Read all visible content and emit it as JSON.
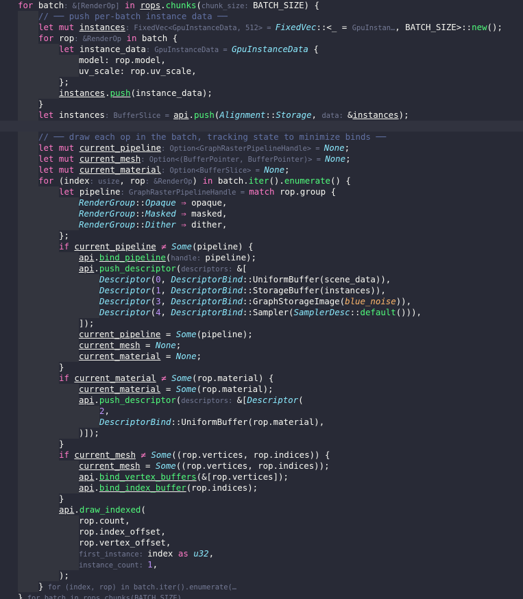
{
  "editor": {
    "theme": {
      "background": "#282a36",
      "keyword": "#ff79c6",
      "function": "#50fa7b",
      "type": "#8be9fd",
      "number": "#bd93f9",
      "comment": "#6272a4",
      "hint": "#747a95",
      "text": "#f8f8f2"
    },
    "lines": [
      {
        "indent": 0,
        "tokens": [
          [
            "kw",
            "for"
          ],
          [
            "pn",
            " batch"
          ],
          [
            "hint",
            ": &[RenderOp]"
          ],
          [
            "kw",
            " in "
          ],
          [
            "pn ul",
            "rops"
          ],
          [
            "pn",
            "."
          ],
          [
            "fn",
            "chunks"
          ],
          [
            "pn",
            "("
          ],
          [
            "hint",
            "chunk_size: "
          ],
          [
            "pn",
            "BATCH_SIZE) {"
          ]
        ]
      },
      {
        "indent": 1,
        "tokens": [
          [
            "cm",
            "// ── push per-batch instance data ──"
          ]
        ]
      },
      {
        "indent": 1,
        "tokens": [
          [
            "kw",
            "let mut "
          ],
          [
            "pn ul",
            "instances"
          ],
          [
            "hint",
            ": FixedVec<GpuInstanceData, 512> = "
          ],
          [
            "ty",
            "FixedVec"
          ],
          [
            "pn",
            "::<_ = "
          ],
          [
            "hint",
            "GpuInstan…"
          ],
          [
            "pn",
            ", BATCH_SIZE>::"
          ],
          [
            "fn",
            "new"
          ],
          [
            "pn",
            "();"
          ]
        ]
      },
      {
        "indent": 1,
        "tokens": [
          [
            "kw",
            "for "
          ],
          [
            "pn",
            "rop"
          ],
          [
            "hint",
            ": &RenderOp"
          ],
          [
            "kw",
            " in "
          ],
          [
            "pn",
            "batch {"
          ]
        ]
      },
      {
        "indent": 2,
        "tokens": [
          [
            "kw",
            "let "
          ],
          [
            "pn",
            "instance_data"
          ],
          [
            "hint",
            ": GpuInstanceData = "
          ],
          [
            "ty",
            "GpuInstanceData"
          ],
          [
            "pn",
            " {"
          ]
        ]
      },
      {
        "indent": 3,
        "tokens": [
          [
            "pn",
            "model: rop.model,"
          ]
        ]
      },
      {
        "indent": 3,
        "tokens": [
          [
            "pn",
            "uv_scale: rop.uv_scale,"
          ]
        ]
      },
      {
        "indent": 2,
        "tokens": [
          [
            "pn",
            "};"
          ]
        ]
      },
      {
        "indent": 2,
        "tokens": [
          [
            "pn ul",
            "instances"
          ],
          [
            "pn",
            "."
          ],
          [
            "fn ul",
            "push"
          ],
          [
            "pn",
            "(instance_data);"
          ]
        ]
      },
      {
        "indent": 1,
        "tokens": [
          [
            "pn",
            "}"
          ]
        ]
      },
      {
        "indent": 1,
        "tokens": [
          [
            "kw",
            "let "
          ],
          [
            "pn",
            "instances"
          ],
          [
            "hint",
            ": BufferSlice = "
          ],
          [
            "pn ul",
            "api"
          ],
          [
            "pn",
            "."
          ],
          [
            "fn",
            "push"
          ],
          [
            "pn",
            "("
          ],
          [
            "ty",
            "Alignment"
          ],
          [
            "pn",
            "::"
          ],
          [
            "ty",
            "Storage"
          ],
          [
            "pn",
            ", "
          ],
          [
            "hint",
            "data: "
          ],
          [
            "pn",
            "&"
          ],
          [
            "pn ul",
            "instances"
          ],
          [
            "pn",
            ");"
          ]
        ]
      },
      {
        "indent": 0,
        "tokens": [
          [
            "pn",
            ""
          ]
        ],
        "cursor": true
      },
      {
        "indent": 1,
        "tokens": [
          [
            "cm",
            "// ── draw each op in the batch, tracking state to minimize binds ──"
          ]
        ]
      },
      {
        "indent": 1,
        "tokens": [
          [
            "kw",
            "let mut "
          ],
          [
            "pn ul",
            "current_pipeline"
          ],
          [
            "hint",
            ": Option<GraphRasterPipelineHandle> = "
          ],
          [
            "ty",
            "None"
          ],
          [
            "pn",
            ";"
          ]
        ]
      },
      {
        "indent": 1,
        "tokens": [
          [
            "kw",
            "let mut "
          ],
          [
            "pn ul",
            "current_mesh"
          ],
          [
            "hint",
            ": Option<(BufferPointer, BufferPointer)> = "
          ],
          [
            "ty",
            "None"
          ],
          [
            "pn",
            ";"
          ]
        ]
      },
      {
        "indent": 1,
        "tokens": [
          [
            "kw",
            "let mut "
          ],
          [
            "pn ul",
            "current_material"
          ],
          [
            "hint",
            ": Option<BufferSlice> = "
          ],
          [
            "ty",
            "None"
          ],
          [
            "pn",
            ";"
          ]
        ]
      },
      {
        "indent": 1,
        "tokens": [
          [
            "kw",
            "for "
          ],
          [
            "pn",
            "(index"
          ],
          [
            "hint",
            ": usize"
          ],
          [
            "pn",
            ", rop"
          ],
          [
            "hint",
            ": &RenderOp"
          ],
          [
            "pn",
            ")"
          ],
          [
            "kw",
            " in "
          ],
          [
            "pn",
            "batch."
          ],
          [
            "fn",
            "iter"
          ],
          [
            "pn",
            "()."
          ],
          [
            "fn",
            "enumerate"
          ],
          [
            "pn",
            "() {"
          ]
        ]
      },
      {
        "indent": 2,
        "tokens": [
          [
            "kw",
            "let "
          ],
          [
            "pn",
            "pipeline"
          ],
          [
            "hint",
            ": GraphRasterPipelineHandle = "
          ],
          [
            "kw",
            "match "
          ],
          [
            "pn",
            "rop.group {"
          ]
        ]
      },
      {
        "indent": 3,
        "tokens": [
          [
            "ty",
            "RenderGroup"
          ],
          [
            "pn",
            "::"
          ],
          [
            "ty",
            "Opaque"
          ],
          [
            "op",
            " ⇒ "
          ],
          [
            "pn",
            "opaque,"
          ]
        ]
      },
      {
        "indent": 3,
        "tokens": [
          [
            "ty",
            "RenderGroup"
          ],
          [
            "pn",
            "::"
          ],
          [
            "ty",
            "Masked"
          ],
          [
            "op",
            " ⇒ "
          ],
          [
            "pn",
            "masked,"
          ]
        ]
      },
      {
        "indent": 3,
        "tokens": [
          [
            "ty",
            "RenderGroup"
          ],
          [
            "pn",
            "::"
          ],
          [
            "ty",
            "Dither"
          ],
          [
            "op",
            " ⇒ "
          ],
          [
            "pn",
            "dither,"
          ]
        ]
      },
      {
        "indent": 2,
        "tokens": [
          [
            "pn",
            "};"
          ]
        ]
      },
      {
        "indent": 2,
        "tokens": [
          [
            "kw",
            "if "
          ],
          [
            "pn ul",
            "current_pipeline"
          ],
          [
            "op",
            " ≠ "
          ],
          [
            "ty",
            "Some"
          ],
          [
            "pn",
            "(pipeline) {"
          ]
        ]
      },
      {
        "indent": 3,
        "tokens": [
          [
            "pn ul",
            "api"
          ],
          [
            "pn",
            "."
          ],
          [
            "fn ul",
            "bind_pipeline"
          ],
          [
            "pn",
            "("
          ],
          [
            "hint",
            "handle: "
          ],
          [
            "pn",
            "pipeline);"
          ]
        ]
      },
      {
        "indent": 3,
        "tokens": [
          [
            "pn ul",
            "api"
          ],
          [
            "pn",
            "."
          ],
          [
            "fn",
            "push_descriptor"
          ],
          [
            "pn",
            "("
          ],
          [
            "hint",
            "descriptors: "
          ],
          [
            "pn",
            "&["
          ]
        ]
      },
      {
        "indent": 4,
        "tokens": [
          [
            "ty",
            "Descriptor"
          ],
          [
            "pn",
            "("
          ],
          [
            "nm",
            "0"
          ],
          [
            "pn",
            ", "
          ],
          [
            "ty",
            "DescriptorBind"
          ],
          [
            "pn",
            "::UniformBuffer(scene_data)),"
          ]
        ]
      },
      {
        "indent": 4,
        "tokens": [
          [
            "ty",
            "Descriptor"
          ],
          [
            "pn",
            "("
          ],
          [
            "nm",
            "1"
          ],
          [
            "pn",
            ", "
          ],
          [
            "ty",
            "DescriptorBind"
          ],
          [
            "pn",
            "::StorageBuffer(instances)),"
          ]
        ]
      },
      {
        "indent": 4,
        "tokens": [
          [
            "ty",
            "Descriptor"
          ],
          [
            "pn",
            "("
          ],
          [
            "nm",
            "3"
          ],
          [
            "pn",
            ", "
          ],
          [
            "ty",
            "DescriptorBind"
          ],
          [
            "pn",
            "::GraphStorageImage("
          ],
          [
            "itp",
            "blue_noise"
          ],
          [
            "pn",
            ")),"
          ]
        ]
      },
      {
        "indent": 4,
        "tokens": [
          [
            "ty",
            "Descriptor"
          ],
          [
            "pn",
            "("
          ],
          [
            "nm",
            "4"
          ],
          [
            "pn",
            ", "
          ],
          [
            "ty",
            "DescriptorBind"
          ],
          [
            "pn",
            "::Sampler("
          ],
          [
            "ty",
            "SamplerDesc"
          ],
          [
            "pn",
            "::"
          ],
          [
            "fn",
            "default"
          ],
          [
            "pn",
            "())),"
          ]
        ]
      },
      {
        "indent": 3,
        "tokens": [
          [
            "pn",
            "]);"
          ]
        ]
      },
      {
        "indent": 3,
        "tokens": [
          [
            "pn ul",
            "current_pipeline"
          ],
          [
            "pn",
            " = "
          ],
          [
            "ty",
            "Some"
          ],
          [
            "pn",
            "(pipeline);"
          ]
        ]
      },
      {
        "indent": 3,
        "tokens": [
          [
            "pn ul",
            "current_mesh"
          ],
          [
            "pn",
            " = "
          ],
          [
            "ty",
            "None"
          ],
          [
            "pn",
            ";"
          ]
        ]
      },
      {
        "indent": 3,
        "tokens": [
          [
            "pn ul",
            "current_material"
          ],
          [
            "pn",
            " = "
          ],
          [
            "ty",
            "None"
          ],
          [
            "pn",
            ";"
          ]
        ]
      },
      {
        "indent": 2,
        "tokens": [
          [
            "pn",
            "}"
          ]
        ]
      },
      {
        "indent": 2,
        "tokens": [
          [
            "kw",
            "if "
          ],
          [
            "pn ul",
            "current_material"
          ],
          [
            "op",
            " ≠ "
          ],
          [
            "ty",
            "Some"
          ],
          [
            "pn",
            "(rop.material) {"
          ]
        ]
      },
      {
        "indent": 3,
        "tokens": [
          [
            "pn ul",
            "current_material"
          ],
          [
            "pn",
            " = "
          ],
          [
            "ty",
            "Some"
          ],
          [
            "pn",
            "(rop.material);"
          ]
        ]
      },
      {
        "indent": 3,
        "tokens": [
          [
            "pn ul",
            "api"
          ],
          [
            "pn",
            "."
          ],
          [
            "fn",
            "push_descriptor"
          ],
          [
            "pn",
            "("
          ],
          [
            "hint",
            "descriptors: "
          ],
          [
            "pn",
            "&["
          ],
          [
            "ty",
            "Descriptor"
          ],
          [
            "pn",
            "("
          ]
        ]
      },
      {
        "indent": 4,
        "tokens": [
          [
            "nm",
            "2"
          ],
          [
            "pn",
            ","
          ]
        ]
      },
      {
        "indent": 4,
        "tokens": [
          [
            "ty",
            "DescriptorBind"
          ],
          [
            "pn",
            "::UniformBuffer(rop.material),"
          ]
        ]
      },
      {
        "indent": 3,
        "tokens": [
          [
            "pn",
            ")]);"
          ]
        ]
      },
      {
        "indent": 2,
        "tokens": [
          [
            "pn",
            "}"
          ]
        ]
      },
      {
        "indent": 2,
        "tokens": [
          [
            "kw",
            "if "
          ],
          [
            "pn ul",
            "current_mesh"
          ],
          [
            "op",
            " ≠ "
          ],
          [
            "ty",
            "Some"
          ],
          [
            "pn",
            "((rop.vertices, rop.indices)) {"
          ]
        ]
      },
      {
        "indent": 3,
        "tokens": [
          [
            "pn ul",
            "current_mesh"
          ],
          [
            "pn",
            " = "
          ],
          [
            "ty",
            "Some"
          ],
          [
            "pn",
            "((rop.vertices, rop.indices));"
          ]
        ]
      },
      {
        "indent": 3,
        "tokens": [
          [
            "pn ul",
            "api"
          ],
          [
            "pn",
            "."
          ],
          [
            "fn ul",
            "bind_vertex_buffers"
          ],
          [
            "pn",
            "(&[rop.vertices]);"
          ]
        ]
      },
      {
        "indent": 3,
        "tokens": [
          [
            "pn ul",
            "api"
          ],
          [
            "pn",
            "."
          ],
          [
            "fn ul",
            "bind_index_buffer"
          ],
          [
            "pn",
            "(rop.indices);"
          ]
        ]
      },
      {
        "indent": 2,
        "tokens": [
          [
            "pn",
            "}"
          ]
        ]
      },
      {
        "indent": 2,
        "tokens": [
          [
            "pn ul",
            "api"
          ],
          [
            "pn",
            "."
          ],
          [
            "fn",
            "draw_indexed"
          ],
          [
            "pn",
            "("
          ]
        ]
      },
      {
        "indent": 3,
        "tokens": [
          [
            "pn",
            "rop.count,"
          ]
        ]
      },
      {
        "indent": 3,
        "tokens": [
          [
            "pn",
            "rop.index_offset,"
          ]
        ]
      },
      {
        "indent": 3,
        "tokens": [
          [
            "pn",
            "rop.vertex_offset,"
          ]
        ]
      },
      {
        "indent": 3,
        "tokens": [
          [
            "hint",
            "first_instance: "
          ],
          [
            "pn",
            "index "
          ],
          [
            "kw",
            "as "
          ],
          [
            "ty",
            "u32"
          ],
          [
            "pn",
            ","
          ]
        ]
      },
      {
        "indent": 3,
        "tokens": [
          [
            "hint",
            "instance_count: "
          ],
          [
            "nm",
            "1"
          ],
          [
            "pn",
            ","
          ]
        ]
      },
      {
        "indent": 2,
        "tokens": [
          [
            "pn",
            ");"
          ]
        ]
      },
      {
        "indent": 1,
        "tokens": [
          [
            "pn",
            "}"
          ],
          [
            "hint",
            " for (index, rop) in batch.iter().enumerate(…"
          ]
        ]
      },
      {
        "indent": 0,
        "tokens": [
          [
            "pn",
            "}"
          ],
          [
            "hint",
            " for batch in rops.chunks(BATCH_SIZE)"
          ]
        ]
      }
    ]
  }
}
